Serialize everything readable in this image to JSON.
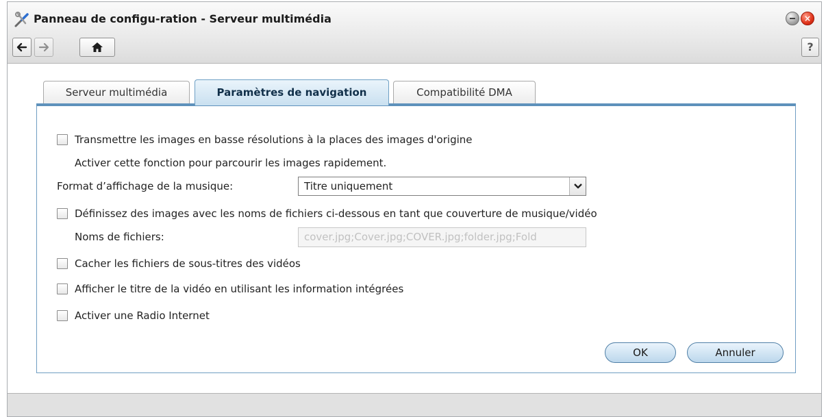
{
  "window": {
    "title": "Panneau de configu-ration - Serveur multimédia",
    "icons": {
      "app": "tools-icon",
      "minimize": "minimize-icon",
      "close": "close-icon"
    },
    "help_label": "?"
  },
  "toolbar": {
    "back_icon": "arrow-left-icon",
    "forward_icon": "arrow-right-icon",
    "home_icon": "home-icon"
  },
  "tabs": [
    {
      "label": "Serveur multimédia",
      "active": false
    },
    {
      "label": "Paramètres de navigation",
      "active": true
    },
    {
      "label": "Compatibilité DMA",
      "active": false
    }
  ],
  "options": {
    "low_res": {
      "label": "Transmettre les images en basse résolutions à la places des images d'origine",
      "checked": false,
      "hint": "Activer cette fonction pour parcourir les images rapidement."
    },
    "music_format": {
      "label": "Format d’affichage de la musique:",
      "value": "Titre uniquement"
    },
    "cover_images": {
      "label": "Définissez des images avec les noms de fichiers ci-dessous en tant que couverture de musique/vidéo",
      "checked": false,
      "filenames_label": "Noms de fichiers:",
      "filenames_value": "cover.jpg;Cover.jpg;COVER.jpg;folder.jpg;Fold"
    },
    "hide_subtitles": {
      "label": "Cacher les fichiers de sous-titres des vidéos",
      "checked": false
    },
    "video_title": {
      "label": "Afficher le titre de la vidéo en utilisant les information intégrées",
      "checked": false
    },
    "internet_radio": {
      "label": "Activer une Radio Internet",
      "checked": false
    }
  },
  "buttons": {
    "ok": "OK",
    "cancel": "Annuler"
  },
  "colors": {
    "accent": "#5e91bb",
    "tab_active": "#c9e0f0",
    "close": "#e0341b"
  }
}
